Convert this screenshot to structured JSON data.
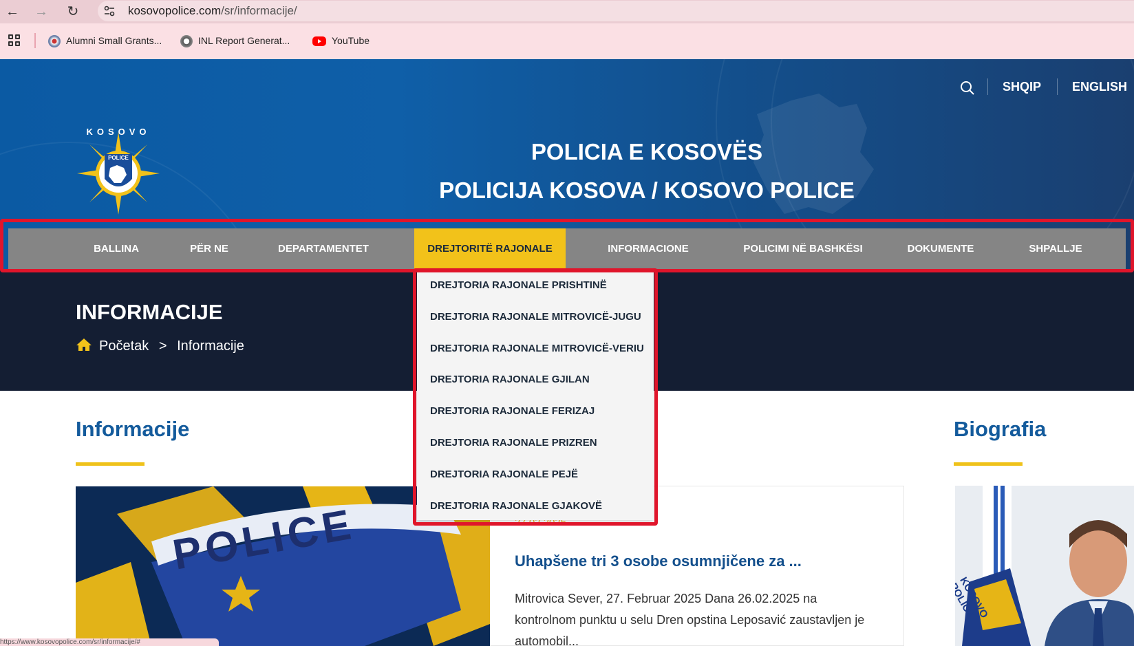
{
  "browser": {
    "url_host": "kosovopolice.com",
    "url_path": "/sr/informacije/",
    "bookmarks": [
      {
        "label": "Alumni Small Grants...",
        "icon": "seal-icon"
      },
      {
        "label": "INL Report Generat...",
        "icon": "seal-icon"
      },
      {
        "label": "YouTube",
        "icon": "youtube-icon"
      }
    ],
    "status_url": "https://www.kosovopolice.com/sr/informacije/#"
  },
  "header": {
    "lang_sq": "SHQIP",
    "lang_en": "ENGLISH",
    "title_line1": "POLICIA E KOSOVËS",
    "title_line2": "POLICIJA KOSOVA / KOSOVO POLICE",
    "logo": {
      "ring_text": "KOSOVO",
      "badge_text": "POLICE"
    }
  },
  "menu": {
    "items": [
      {
        "label": "BALLINA"
      },
      {
        "label": "PËR NE"
      },
      {
        "label": "DEPARTAMENTET"
      },
      {
        "label": "DREJTORITË RAJONALE",
        "active": true
      },
      {
        "label": "INFORMACIONE"
      },
      {
        "label": "POLICIMI NË BASHKËSI"
      },
      {
        "label": "DOKUMENTE"
      },
      {
        "label": "SHPALLJE"
      }
    ],
    "active_color": "#f2c21a"
  },
  "dropdown": {
    "items": [
      "DREJTORIA RAJONALE PRISHTINË",
      "DREJTORIA RAJONALE MITROVICË-JUGU",
      "DREJTORIA RAJONALE MITROVICË-VERIU",
      "DREJTORIA RAJONALE GJILAN",
      "DREJTORIA RAJONALE FERIZAJ",
      "DREJTORIA RAJONALE PRIZREN",
      "DREJTORIA RAJONALE PEJË",
      "DREJTORIA RAJONALE GJAKOVË"
    ]
  },
  "page": {
    "title": "INFORMACIJE",
    "breadcrumb": {
      "home": "Početak",
      "separator": ">",
      "current": "Informacije"
    }
  },
  "content": {
    "left_heading": "Informacije",
    "right_heading": "Biografia",
    "news": {
      "image_text": "POLICE",
      "date": "27.02.2025",
      "title": "Uhapšene tri 3 osobe osumnjičene za ...",
      "excerpt": "Mitrovica Sever, 27. Februar 2025 Dana 26.02.2025 na kontrolnom punktu u selu Dren opstina Leposavić zaustavljen je automobil..."
    },
    "bio_badge_text": "KOSOVO POLICE"
  },
  "colors": {
    "accent_yellow": "#efc21a",
    "heading_blue": "#145b9c",
    "dark_band": "#141e33",
    "menu_gray": "#858585",
    "highlight_red": "#e0152b"
  }
}
